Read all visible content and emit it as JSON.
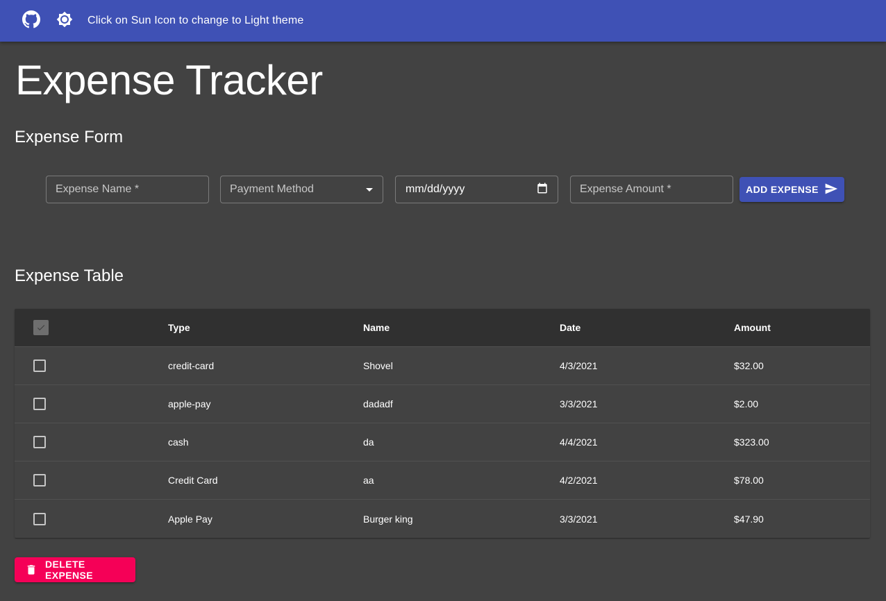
{
  "header": {
    "github_icon": "github-icon",
    "theme_icon": "brightness-icon",
    "hint": "Click on Sun Icon to change to Light theme",
    "bg_color": "#3f51b5"
  },
  "page": {
    "title": "Expense Tracker"
  },
  "form": {
    "title": "Expense Form",
    "name_placeholder": "Expense Name *",
    "payment_placeholder": "Payment Method",
    "date_placeholder": "mm/dd/yyyy",
    "amount_placeholder": "Expense Amount *",
    "submit_label": "ADD EXPENSE",
    "submit_icon": "send-icon"
  },
  "table": {
    "title": "Expense Table",
    "columns": [
      "Type",
      "Name",
      "Date",
      "Amount"
    ],
    "rows": [
      {
        "type": "credit-card",
        "name": "Shovel",
        "date": "4/3/2021",
        "amount": "$32.00"
      },
      {
        "type": "apple-pay",
        "name": "dadadf",
        "date": "3/3/2021",
        "amount": "$2.00"
      },
      {
        "type": "cash",
        "name": "da",
        "date": "4/4/2021",
        "amount": "$323.00"
      },
      {
        "type": "Credit Card",
        "name": "aa",
        "date": "4/2/2021",
        "amount": "$78.00"
      },
      {
        "type": "Apple Pay",
        "name": "Burger king",
        "date": "3/3/2021",
        "amount": "$47.90"
      }
    ]
  },
  "actions": {
    "delete_label": "DELETE EXPENSE",
    "delete_icon": "trash-icon",
    "delete_color": "#f50057"
  }
}
